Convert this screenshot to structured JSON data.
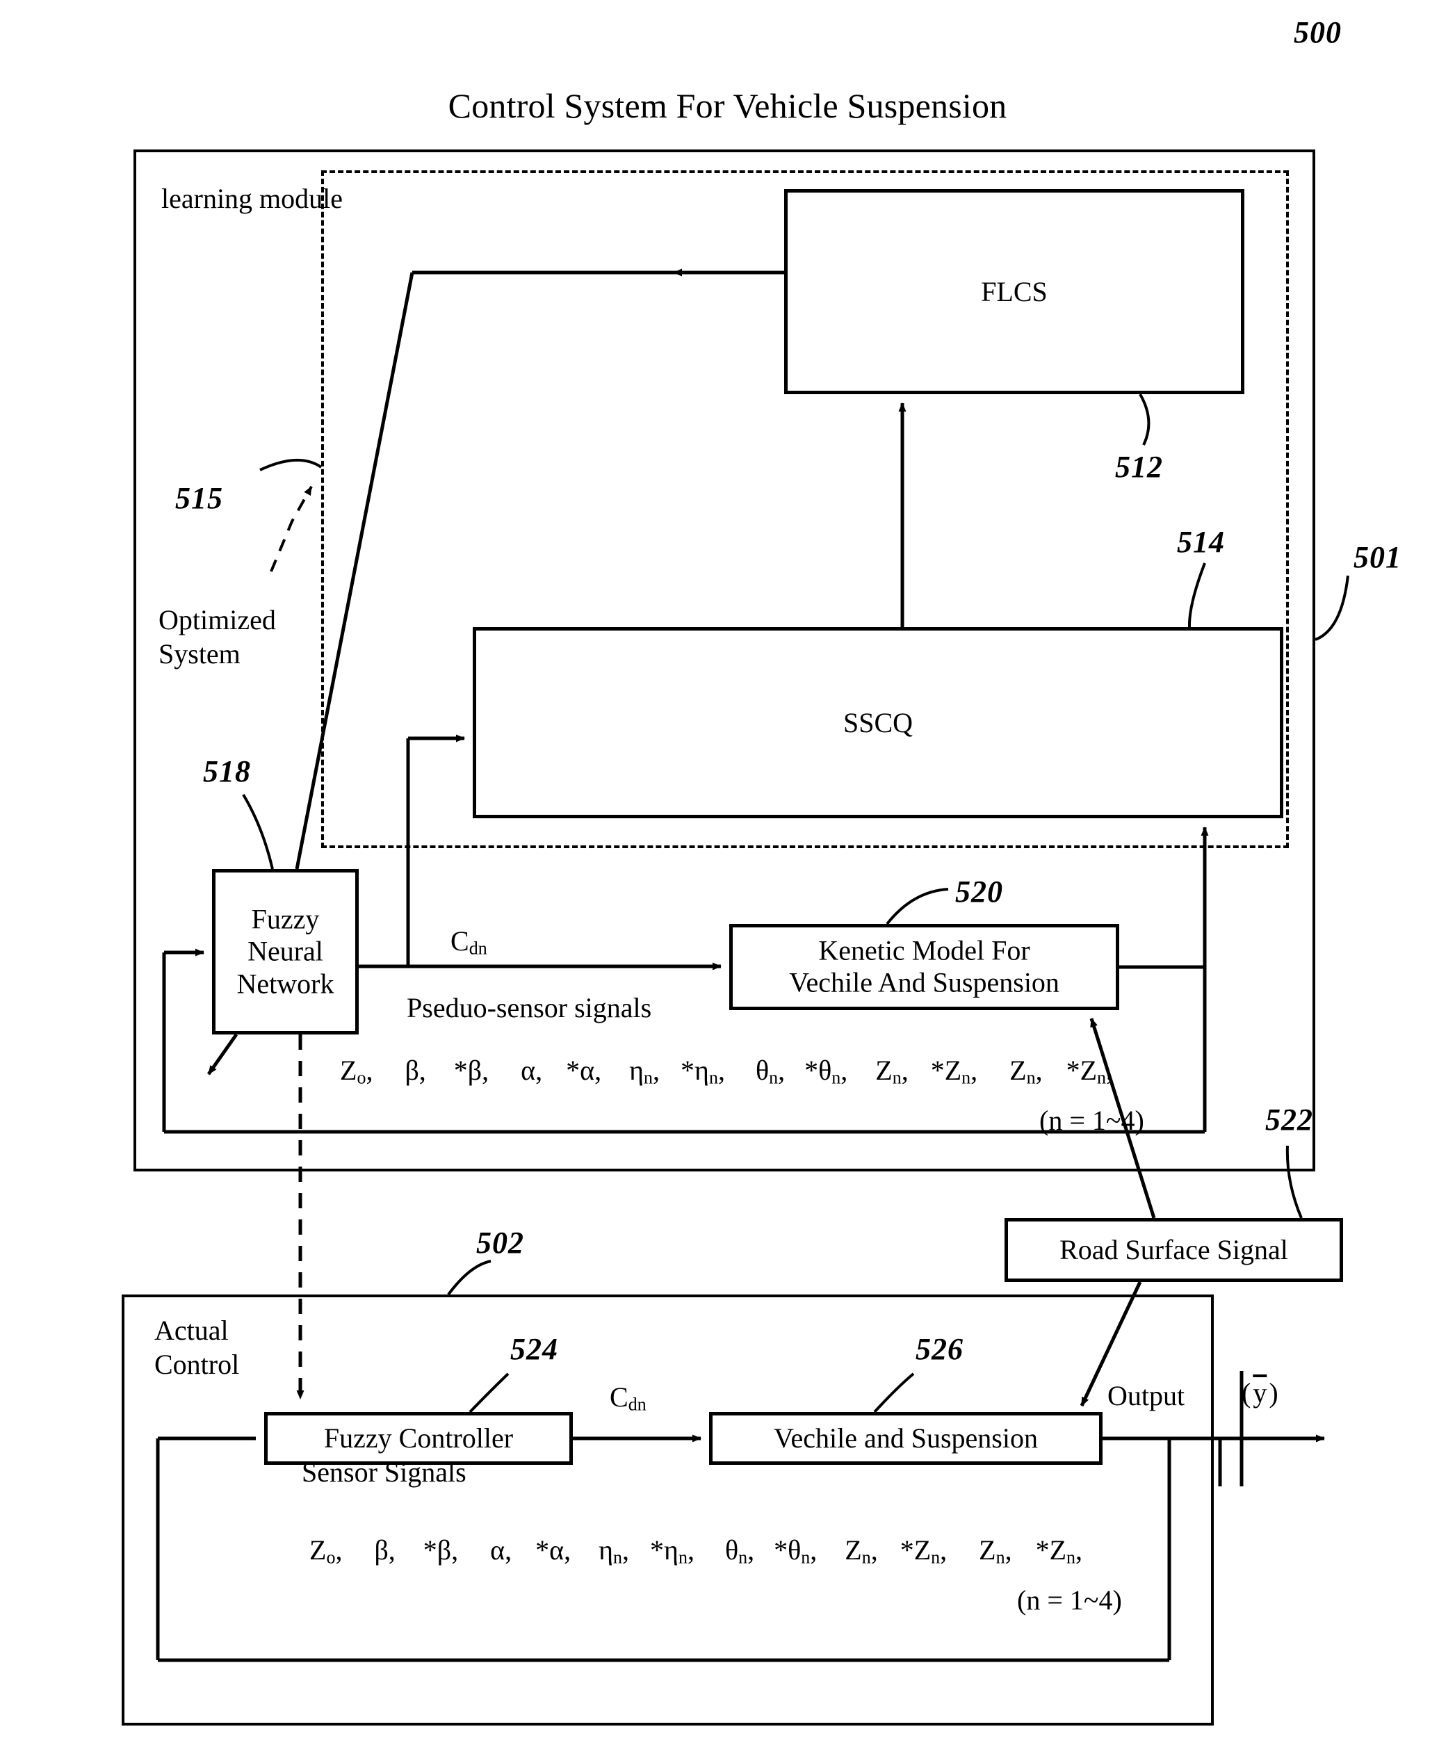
{
  "figure": {
    "number": "500",
    "title": "Control System For Vehicle Suspension"
  },
  "learning_section": {
    "label": "learning module",
    "ref": "501",
    "inner_dashed_ref": "515",
    "optimized_label_line1": "Optimized",
    "optimized_label_line2": "System"
  },
  "blocks": {
    "flcs": {
      "label": "FLCS",
      "ref": "512"
    },
    "sscq": {
      "label": "SSCQ",
      "ref": "514"
    },
    "fnn": {
      "label_line1": "Fuzzy",
      "label_line2": "Neural",
      "label_line3": "Network",
      "ref": "518"
    },
    "kinetic_model": {
      "label_line1": "Kenetic Model For",
      "label_line2": "Vechile And Suspension",
      "ref": "520"
    },
    "road_surface": {
      "label": "Road Surface Signal",
      "ref": "522"
    },
    "fuzzy_controller": {
      "label": "Fuzzy Controller",
      "ref": "524"
    },
    "vehicle_suspension": {
      "label": "Vechile and Suspension",
      "ref": "526"
    }
  },
  "actual_section": {
    "label_line1": "Actual",
    "label_line2": "Control",
    "ref": "502"
  },
  "signals": {
    "cdn_upper": {
      "base": "C",
      "sub": "dn"
    },
    "cdn_lower": {
      "base": "C",
      "sub": "dn"
    },
    "pseudo_sensor_label": "Pseduo-sensor signals",
    "sensor_label": "Sensor Signals",
    "output_label": "Output",
    "output_variable_open": "(",
    "output_variable": "y",
    "output_variable_close": ")",
    "range_note": "(n = 1~4)",
    "symbol_list": [
      {
        "base": "Z",
        "sub": "o",
        "star": false
      },
      {
        "base": "β",
        "sub": "",
        "star": false
      },
      {
        "base": "β",
        "sub": "",
        "star": true
      },
      {
        "base": "α",
        "sub": "",
        "star": false
      },
      {
        "base": "α",
        "sub": "",
        "star": true
      },
      {
        "base": "η",
        "sub": "n",
        "star": false
      },
      {
        "base": "η",
        "sub": "n",
        "star": true
      },
      {
        "base": "θ",
        "sub": "n",
        "star": false
      },
      {
        "base": "θ",
        "sub": "n",
        "star": true
      },
      {
        "base": "Z",
        "sub": "n",
        "star": false
      },
      {
        "base": "Z",
        "sub": "n",
        "star": true
      },
      {
        "base": "Z",
        "sub": "n",
        "star": false
      },
      {
        "base": "Z",
        "sub": "n",
        "star": true
      }
    ]
  },
  "colors": {
    "ink": "#000000",
    "paper": "#ffffff"
  }
}
